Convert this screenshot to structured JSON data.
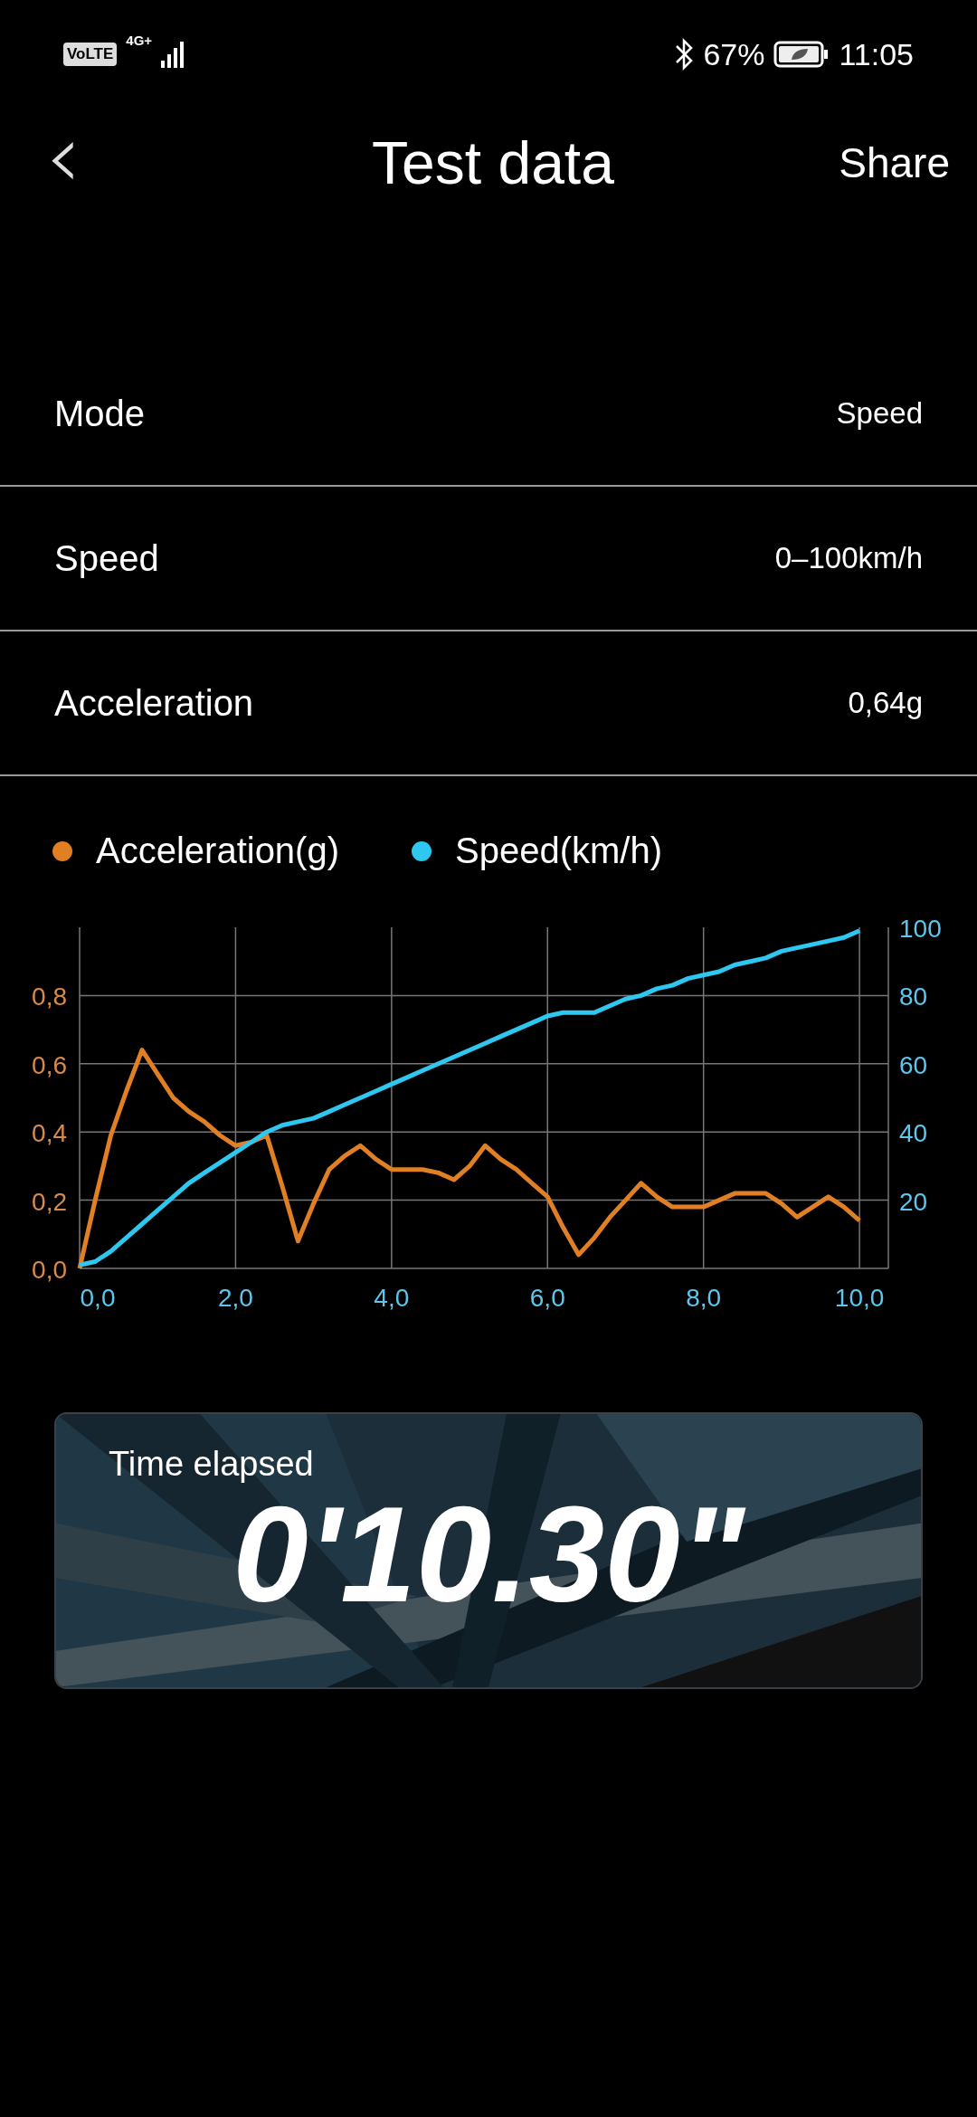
{
  "status_bar": {
    "volte": "VoLTE",
    "network": "4G+",
    "battery": "67%",
    "time": "11:05"
  },
  "header": {
    "back": "‹",
    "title": "Test data",
    "action": "Share"
  },
  "rows": [
    {
      "label": "Mode",
      "value": "Speed"
    },
    {
      "label": "Speed",
      "value": "0–100km/h"
    },
    {
      "label": "Acceleration",
      "value": "0,64g"
    }
  ],
  "chart": {
    "chart_data": {
      "type": "line",
      "x": [
        0,
        0.2,
        0.4,
        0.6,
        0.8,
        1,
        1.2,
        1.4,
        1.6,
        1.8,
        2,
        2.2,
        2.4,
        2.6,
        2.8,
        3,
        3.2,
        3.4,
        3.6,
        3.8,
        4,
        4.2,
        4.4,
        4.6,
        4.8,
        5,
        5.2,
        5.4,
        5.6,
        5.8,
        6,
        6.2,
        6.4,
        6.6,
        6.8,
        7,
        7.2,
        7.4,
        7.6,
        7.8,
        8,
        8.2,
        8.4,
        8.6,
        8.8,
        9,
        9.2,
        9.4,
        9.6,
        9.8,
        10
      ],
      "series": [
        {
          "name": "Acceleration(g)",
          "color": "#e07f24",
          "axis": "y",
          "values": [
            0,
            0.2,
            0.39,
            0.52,
            0.64,
            0.57,
            0.5,
            0.46,
            0.43,
            0.39,
            0.36,
            0.37,
            0.39,
            0.24,
            0.08,
            0.19,
            0.29,
            0.33,
            0.36,
            0.32,
            0.29,
            0.29,
            0.29,
            0.28,
            0.26,
            0.3,
            0.36,
            0.32,
            0.29,
            0.25,
            0.21,
            0.12,
            0.04,
            0.09,
            0.15,
            0.2,
            0.25,
            0.21,
            0.18,
            0.18,
            0.18,
            0.2,
            0.22,
            0.22,
            0.22,
            0.19,
            0.15,
            0.18,
            0.21,
            0.18,
            0.14
          ]
        },
        {
          "name": "Speed(km/h)",
          "color": "#2ec7f0",
          "axis": "y2",
          "values": [
            1,
            2,
            5,
            9,
            13,
            17,
            21,
            25,
            28,
            31,
            34,
            37,
            40,
            42,
            43,
            44,
            46,
            48,
            50,
            52,
            54,
            56,
            58,
            60,
            62,
            64,
            66,
            68,
            70,
            72,
            74,
            75,
            75,
            75,
            77,
            79,
            80,
            82,
            83,
            85,
            86,
            87,
            89,
            90,
            91,
            93,
            94,
            95,
            96,
            97,
            99
          ]
        }
      ],
      "grid": true,
      "xlim": [
        0,
        10.37
      ],
      "ylim": [
        0,
        1
      ],
      "y2lim": [
        0,
        100
      ],
      "xticks": [
        {
          "value": 0,
          "label": "0,0"
        },
        {
          "value": 2,
          "label": "2,0"
        },
        {
          "value": 4,
          "label": "4,0"
        },
        {
          "value": 6,
          "label": "6,0"
        },
        {
          "value": 8,
          "label": "8,0"
        },
        {
          "value": 10,
          "label": "10,0"
        }
      ],
      "yticks": [
        {
          "value": 0,
          "label": "0,0"
        },
        {
          "value": 0.2,
          "label": "0,2"
        },
        {
          "value": 0.4,
          "label": "0,4"
        },
        {
          "value": 0.6,
          "label": "0,6"
        },
        {
          "value": 0.8,
          "label": "0,8"
        }
      ],
      "y2ticks": [
        20,
        40,
        60,
        80,
        100
      ]
    }
  },
  "result": {
    "label": "Time elapsed",
    "value": "0'10.30\""
  }
}
